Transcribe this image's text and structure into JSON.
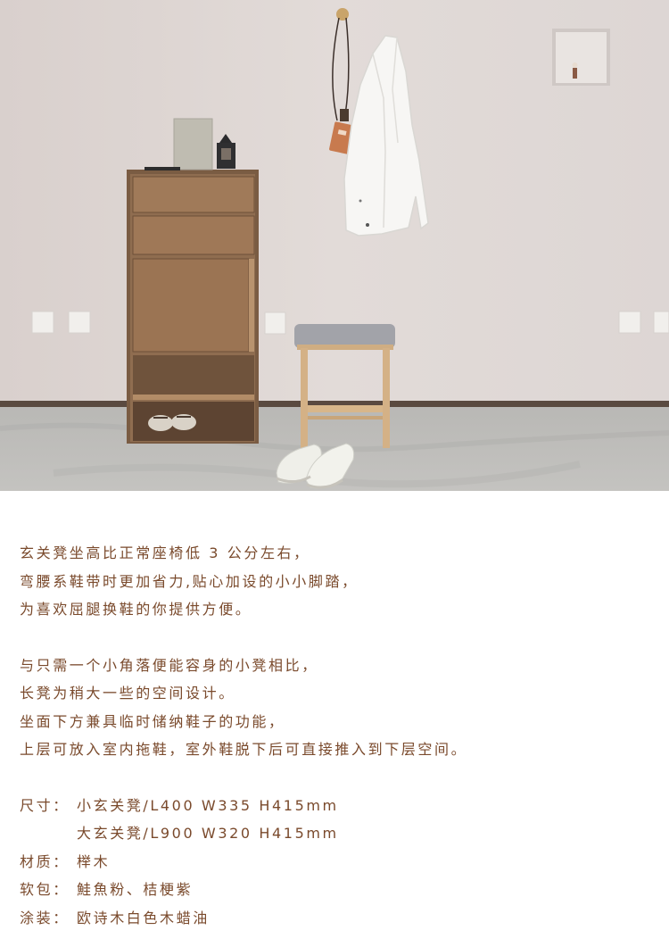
{
  "image": {
    "subject": "entryway-with-cabinet-stool-shirt-and-sneakers",
    "colors": {
      "wall": "#dcd5d3",
      "floor": "#b7b6b3",
      "cabinet": "#8c6a4d",
      "stool_wood": "#d2ae7f",
      "cushion": "#9fa0a6",
      "text": "#7a4a2c"
    }
  },
  "copy": {
    "paragraph1": [
      "玄关凳坐高比正常座椅低 3 公分左右，",
      "弯腰系鞋带时更加省力,贴心加设的小小脚踏，",
      "为喜欢屈腿换鞋的你提供方便。"
    ],
    "paragraph2": [
      "与只需一个小角落便能容身的小凳相比，",
      "长凳为稍大一些的空间设计。",
      "坐面下方兼具临时储纳鞋子的功能，",
      "上层可放入室内拖鞋，室外鞋脱下后可直接推入到下层空间。"
    ]
  },
  "specs": {
    "size_label": "尺寸：",
    "size_small": "小玄关凳/L400 W335 H415mm",
    "size_large": "大玄关凳/L900 W320 H415mm",
    "material_label": "材质：",
    "material": "榉木",
    "upholstery_label": "软包：",
    "upholstery": "鮭魚粉、桔梗紫",
    "finish_label": "涂装：",
    "finish": "欧诗木白色木蜡油"
  }
}
